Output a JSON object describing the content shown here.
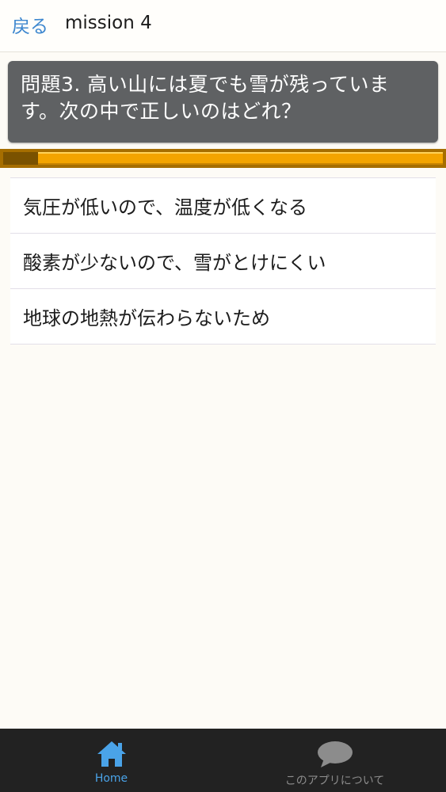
{
  "header": {
    "back_label": "戻る",
    "title": "mission 4"
  },
  "question": {
    "text": "問題3. 高い山には夏でも雪が残っています。次の中で正しいのはどれ？"
  },
  "progress": {
    "fraction": 0.08
  },
  "answers": [
    "気圧が低いので、温度が低くなる",
    "酸素が少ないので、雪がとけにくい",
    "地球の地熱が伝わらないため"
  ],
  "tabbar": {
    "home_label": "Home",
    "home_icon": "home-icon",
    "about_label": "このアプリについて",
    "about_icon": "chat-bubble-icon"
  },
  "colors": {
    "accent": "#3d87cf",
    "question_bg": "#5f6163",
    "progress": "#f3a400",
    "tab_active": "#4aa3e8",
    "tabbar_bg": "#222222"
  }
}
